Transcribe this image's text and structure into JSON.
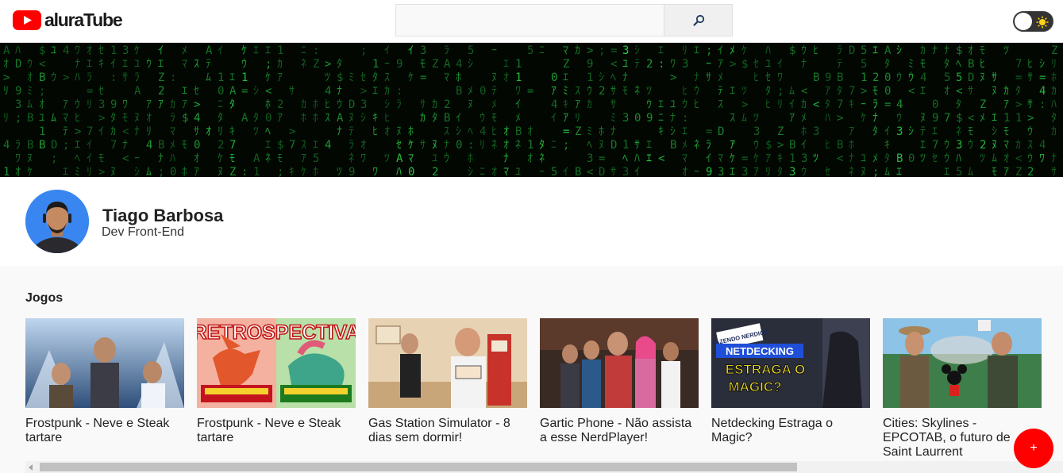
{
  "header": {
    "logo_text": "aluraTube",
    "search": {
      "value": "",
      "placeholder": ""
    },
    "search_icon": "magnifier-icon",
    "theme_toggle_icon": "sun-icon"
  },
  "banner": {
    "image": "matrix-code-rain"
  },
  "profile": {
    "name": "Tiago Barbosa",
    "role": "Dev Front-End"
  },
  "timeline": {
    "section_title": "Jogos",
    "videos": [
      {
        "title": "Frostpunk - Neve e Steak tartare"
      },
      {
        "title": "Frostpunk - Neve e Steak tartare"
      },
      {
        "title": "Gas Station Simulator - 8 dias sem dormir!"
      },
      {
        "title": "Gartic Phone - Não assista a esse NerdPlayer!"
      },
      {
        "title": "Netdecking Estraga o Magic?"
      },
      {
        "title": "Cities: Skylines - EPCOTAB, o futuro de Saint Laurrent"
      }
    ]
  },
  "thumb_text": {
    "retrospectiva": "RETROSPECTIVA",
    "netdecking": "NETDECKING",
    "estraga": "ESTRAGA O",
    "magic": "MAGIC?",
    "fazendo": "FAZENDO NERDICE"
  },
  "fab": {
    "label": "+"
  },
  "colors": {
    "brand": "#ff0000",
    "matrix_green": "#1fbf3a"
  }
}
